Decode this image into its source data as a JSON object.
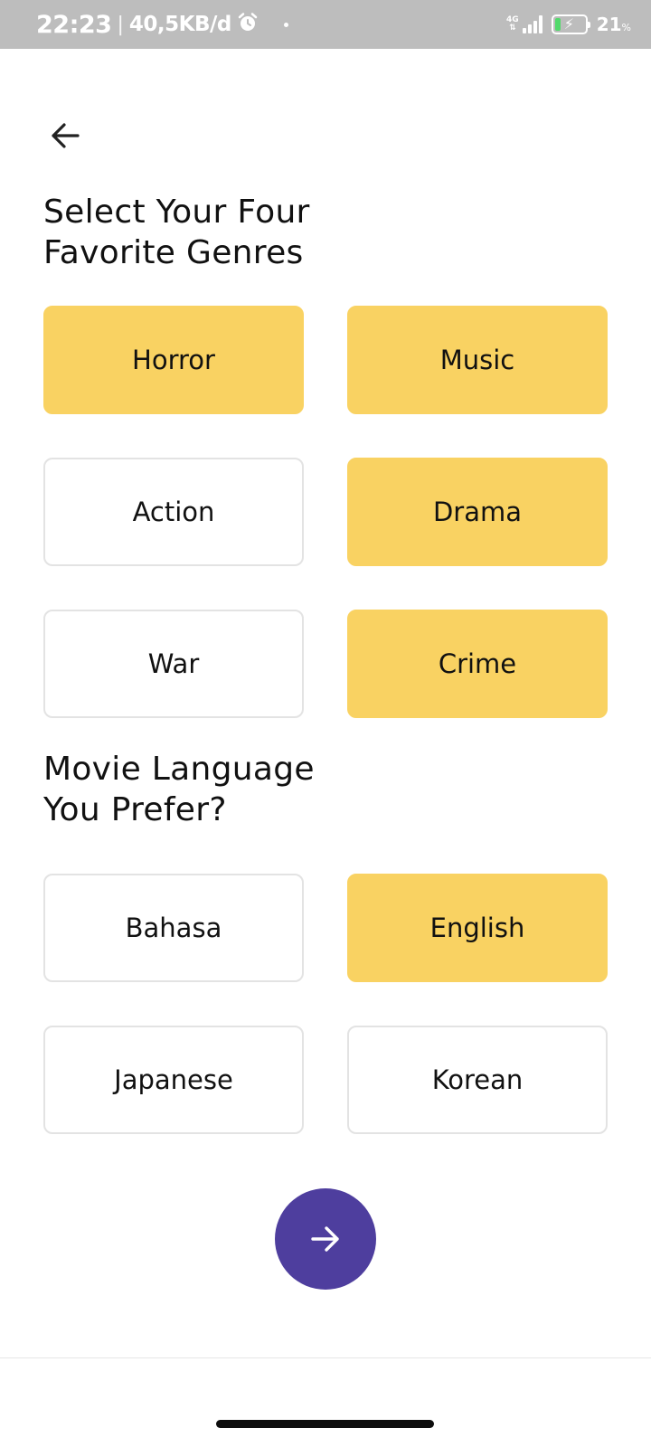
{
  "status_bar": {
    "time": "22:23",
    "separator": "|",
    "net_speed": "40,5KB/d",
    "network_type": "4G",
    "battery_percent": "21",
    "battery_unit": "%",
    "battery_level": 0.21,
    "icons": [
      "alarm-icon",
      "signal-icon",
      "battery-charging-icon"
    ]
  },
  "header": {
    "back_icon": "arrow-left-icon"
  },
  "genres": {
    "title_line1": "Select Your Four",
    "title_line2": "Favorite Genres",
    "options": [
      {
        "label": "Horror",
        "selected": true
      },
      {
        "label": "Music",
        "selected": true
      },
      {
        "label": "Action",
        "selected": false
      },
      {
        "label": "Drama",
        "selected": true
      },
      {
        "label": "War",
        "selected": false
      },
      {
        "label": "Crime",
        "selected": true
      }
    ]
  },
  "language": {
    "title_line1": "Movie Language",
    "title_line2": "You Prefer?",
    "options": [
      {
        "label": "Bahasa",
        "selected": false
      },
      {
        "label": "English",
        "selected": true
      },
      {
        "label": "Japanese",
        "selected": false
      },
      {
        "label": "Korean",
        "selected": false
      }
    ]
  },
  "next_button": {
    "icon": "arrow-right-icon"
  },
  "colors": {
    "selected": "#f9d262",
    "unselected_border": "#e3e3e3",
    "accent": "#4e3e9e",
    "status_bar": "#bdbdbd"
  }
}
